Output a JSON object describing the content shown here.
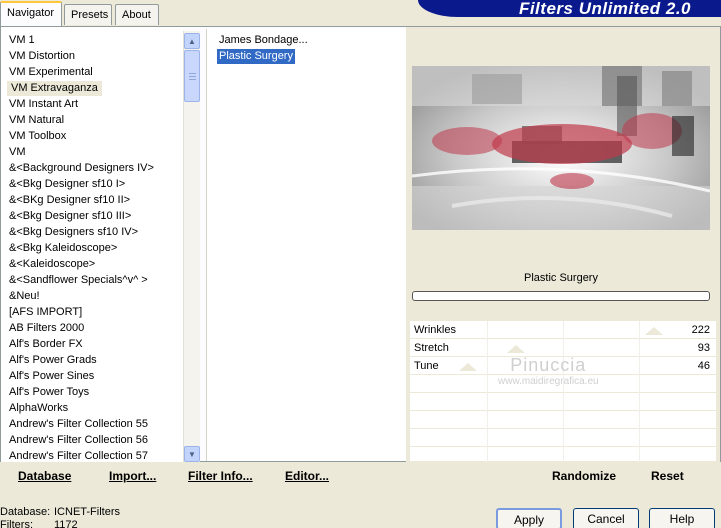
{
  "tabs": [
    {
      "label": "Navigator"
    },
    {
      "label": "Presets"
    },
    {
      "label": "About"
    }
  ],
  "banner": {
    "title": "Filters Unlimited 2.0"
  },
  "categories": [
    "VM 1",
    "VM Distortion",
    "VM Experimental",
    "VM Extravaganza",
    "VM Instant Art",
    "VM Natural",
    "VM Toolbox",
    "VM",
    "&<Background Designers IV>",
    "&<Bkg Designer sf10 I>",
    "&<BKg Designer sf10 II>",
    "&<Bkg Designer sf10 III>",
    "&<Bkg Designers sf10 IV>",
    "&<Bkg Kaleidoscope>",
    "&<Kaleidoscope>",
    "&<Sandflower Specials^v^ >",
    "&Neu!",
    "[AFS IMPORT]",
    "AB Filters 2000",
    "Alf's Border FX",
    "Alf's Power Grads",
    "Alf's Power Sines",
    "Alf's Power Toys",
    "AlphaWorks",
    "Andrew's Filter Collection 55",
    "Andrew's Filter Collection 56",
    "Andrew's Filter Collection 57"
  ],
  "selected_category": "VM Extravaganza",
  "filters": [
    "James Bondage...",
    "Plastic Surgery"
  ],
  "selected_filter": "Plastic Surgery",
  "current_filter_name": "Plastic Surgery",
  "sliders": [
    {
      "label": "Wrinkles",
      "value": "222",
      "level": 0.87
    },
    {
      "label": "Stretch",
      "value": "93",
      "level": 0.36
    },
    {
      "label": "Tune",
      "value": "46",
      "level": 0.18
    }
  ],
  "watermark": {
    "name": "Pinuccia",
    "url": "www.maidiregrafica.eu"
  },
  "toolbar": {
    "database": "Database",
    "import": "Import...",
    "filter_info": "Filter Info...",
    "editor": "Editor...",
    "randomize": "Randomize",
    "reset": "Reset"
  },
  "status": {
    "database_label": "Database:",
    "database_value": "ICNET-Filters",
    "filters_label": "Filters:",
    "filters_value": "1172"
  },
  "buttons": {
    "apply": "Apply",
    "cancel": "Cancel",
    "help": "Help"
  },
  "colors": {
    "banner": "#0a1a8c",
    "selection": "#316ac5",
    "accent_red": "#c0394b"
  }
}
